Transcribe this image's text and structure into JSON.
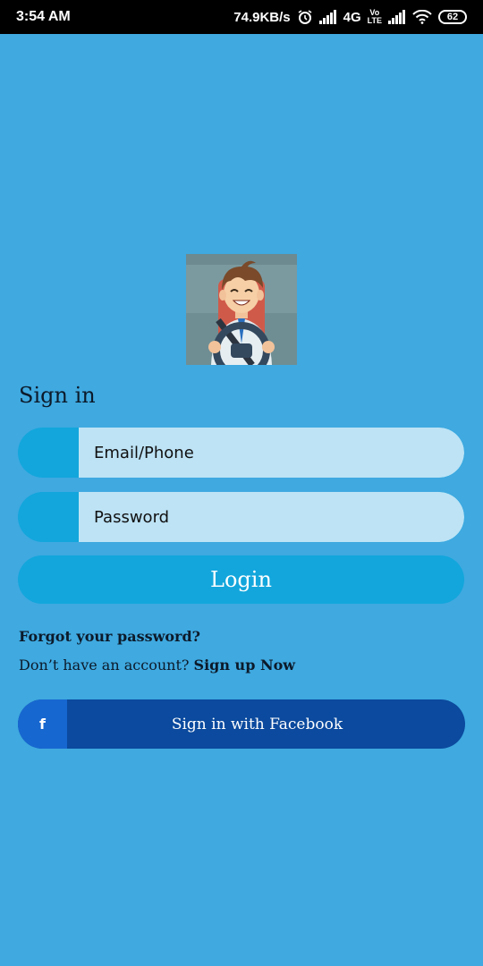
{
  "status_bar": {
    "time": "3:54 AM",
    "speed": "74.9KB/s",
    "network": "4G",
    "volte_top": "Vo",
    "volte_bottom": "LTE",
    "battery": "62"
  },
  "signin": {
    "title": "Sign in",
    "email_placeholder": "Email/Phone",
    "password_placeholder": "Password",
    "login_label": "Login",
    "forgot_label": "Forgot your password?",
    "no_account_text": "Don’t have an account? ",
    "signup_label": "Sign up Now"
  },
  "facebook": {
    "icon_glyph": "f",
    "label": "Sign in with Facebook"
  },
  "colors": {
    "background": "#3fa9e0",
    "field_accent": "#12a6dc",
    "field_fill": "#bde3f5",
    "facebook": "#0b4a9e"
  }
}
